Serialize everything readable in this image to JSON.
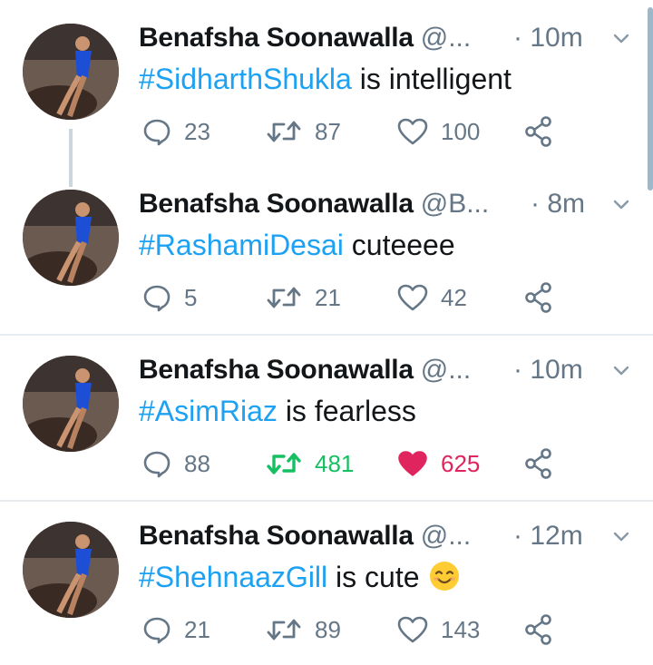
{
  "colors": {
    "hashtag": "#1da1f2",
    "secondary_text": "#657786",
    "retweet_active": "#17bf63",
    "like_active": "#e0245e",
    "divider": "#e6ecf0"
  },
  "tweets": [
    {
      "name": "Benafsha Soonawalla",
      "handle": "@...",
      "time": "· 10m",
      "hashtag": "#SidharthShukla",
      "text": " is intelligent",
      "replies": "23",
      "retweets": "87",
      "likes": "100",
      "retweeted": false,
      "liked": false,
      "emoji": null
    },
    {
      "name": "Benafsha Soonawalla",
      "handle": "@B...",
      "time": "· 8m",
      "hashtag": "#RashamiDesai",
      "text": " cuteeee",
      "replies": "5",
      "retweets": "21",
      "likes": "42",
      "retweeted": false,
      "liked": false,
      "emoji": null
    },
    {
      "name": "Benafsha Soonawalla",
      "handle": "@...",
      "time": "· 10m",
      "hashtag": "#AsimRiaz",
      "text": " is fearless",
      "replies": "88",
      "retweets": "481",
      "likes": "625",
      "retweeted": true,
      "liked": true,
      "emoji": null
    },
    {
      "name": "Benafsha Soonawalla",
      "handle": "@...",
      "time": "· 12m",
      "hashtag": "#ShehnaazGill",
      "text": " is cute ",
      "replies": "21",
      "retweets": "89",
      "likes": "143",
      "retweeted": false,
      "liked": false,
      "emoji": "smiling-face-emoji"
    }
  ]
}
